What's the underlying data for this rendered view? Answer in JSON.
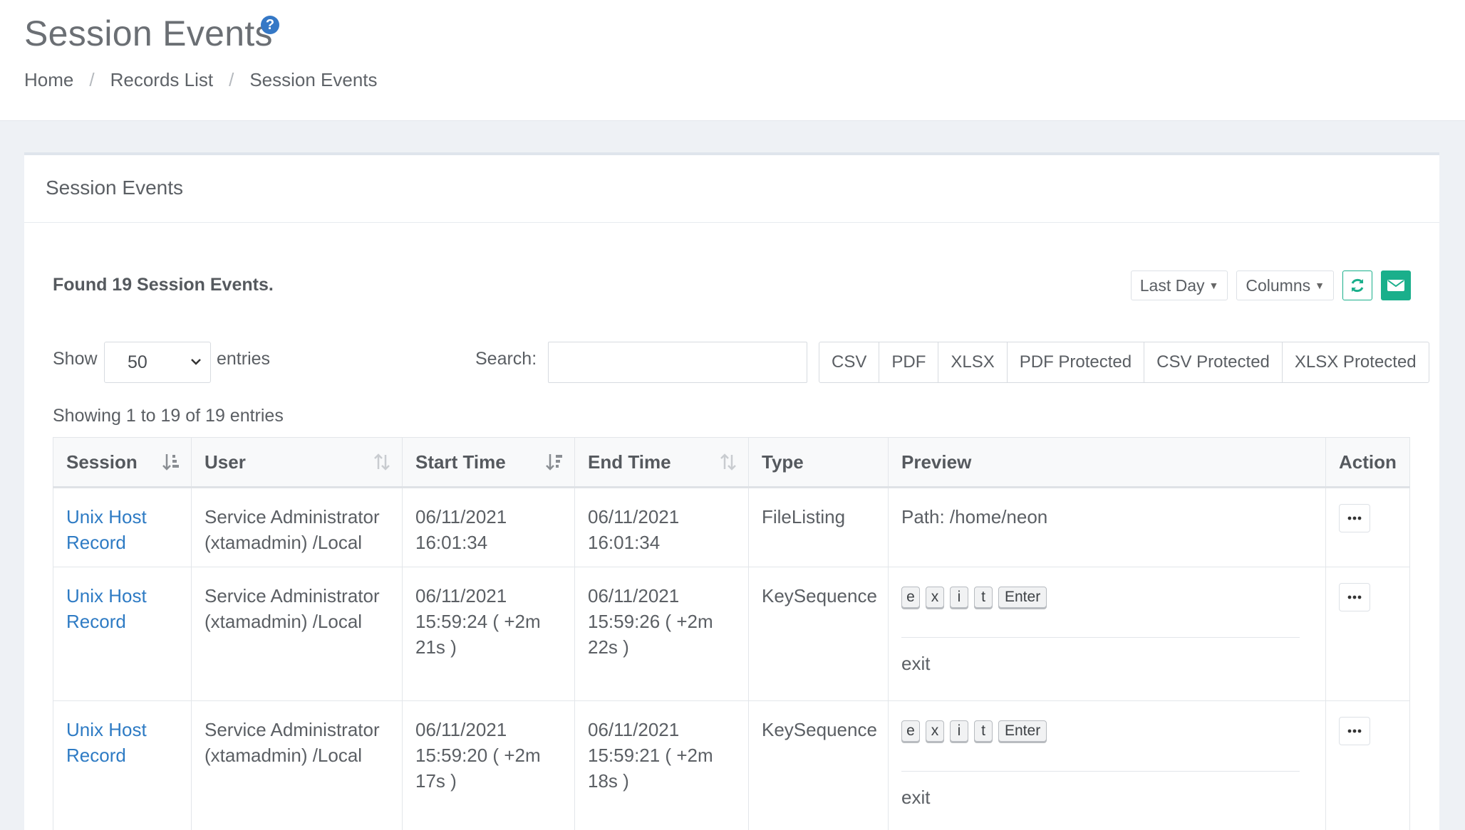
{
  "header": {
    "title": "Session Events",
    "breadcrumb": [
      "Home",
      "Records List",
      "Session Events"
    ]
  },
  "panel": {
    "title": "Session Events",
    "found_text": "Found 19 Session Events.",
    "filters": {
      "range_label": "Last Day",
      "columns_label": "Columns"
    }
  },
  "table_controls": {
    "show_label": "Show",
    "page_size": "50",
    "entries_label": "entries",
    "search_label": "Search:",
    "search_value": "",
    "export_buttons": [
      "CSV",
      "PDF",
      "XLSX",
      "PDF Protected",
      "CSV Protected",
      "XLSX Protected"
    ],
    "info_text": "Showing 1 to 19 of 19 entries"
  },
  "table": {
    "columns": [
      "Session",
      "User",
      "Start Time",
      "End Time",
      "Type",
      "Preview",
      "Action"
    ],
    "rows": [
      {
        "session": "Unix Host Record",
        "user": "Service Administrator (xtamadmin) /Local",
        "start": "06/11/2021 16:01:34",
        "end": "06/11/2021 16:01:34",
        "type": "FileListing",
        "preview": "Path: /home/neon"
      },
      {
        "session": "Unix Host Record",
        "user": "Service Administrator (xtamadmin) /Local",
        "start": "06/11/2021 15:59:24 ( +2m 21s )",
        "end": "06/11/2021 15:59:26 ( +2m 22s )",
        "type": "KeySequence",
        "keys": [
          "e",
          "x",
          "i",
          "t",
          "Enter"
        ],
        "preview_text": "exit"
      },
      {
        "session": "Unix Host Record",
        "user": "Service Administrator (xtamadmin) /Local",
        "start": "06/11/2021 15:59:20 ( +2m 17s )",
        "end": "06/11/2021 15:59:21 ( +2m 18s )",
        "type": "KeySequence",
        "keys": [
          "e",
          "x",
          "i",
          "t",
          "Enter"
        ],
        "preview_text": "exit"
      }
    ]
  },
  "icons": {
    "help": "question-circle-icon",
    "refresh": "refresh-icon",
    "email": "envelope-icon",
    "action": "ellipsis-icon"
  },
  "colors": {
    "accent": "#1aaf8b",
    "link": "#2e7bc4",
    "help": "#3578c6"
  }
}
